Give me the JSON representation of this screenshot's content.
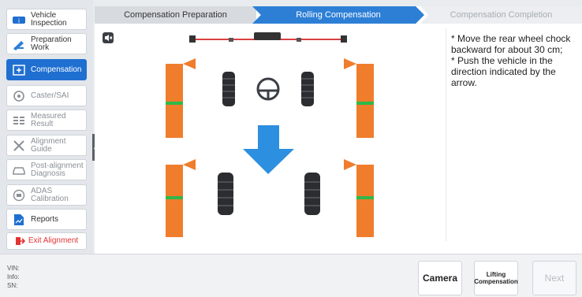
{
  "sidebar": {
    "items": [
      {
        "label_line1": "Vehicle",
        "label_line2": "Inspection",
        "icon": "car-info-icon",
        "state": "normal"
      },
      {
        "label_line1": "Preparation",
        "label_line2": "Work",
        "icon": "wrench-pencil-icon",
        "state": "normal"
      },
      {
        "label_line1": "Compensation",
        "label_line2": "",
        "icon": "compensation-icon",
        "state": "active"
      },
      {
        "label_line1": "Caster/SAI",
        "label_line2": "",
        "icon": "wheel-icon",
        "state": "disabled"
      },
      {
        "label_line1": "Measured",
        "label_line2": "Result",
        "icon": "list-icon",
        "state": "disabled"
      },
      {
        "label_line1": "Alignment",
        "label_line2": "Guide",
        "icon": "tools-icon",
        "state": "disabled"
      },
      {
        "label_line1": "Post-alignment",
        "label_line2": "Diagnosis",
        "icon": "car-diagnosis-icon",
        "state": "disabled"
      },
      {
        "label_line1": "ADAS",
        "label_line2": "Calibration",
        "icon": "adas-icon",
        "state": "disabled"
      },
      {
        "label_line1": "Reports",
        "label_line2": "",
        "icon": "report-icon",
        "state": "normal"
      }
    ],
    "exit_label": "Exit Alignment"
  },
  "steps": [
    "Compensation Preparation",
    "Rolling Compensation",
    "Compensation Completion"
  ],
  "instructions": [
    "* Move the rear wheel chock backward for about 30 cm;",
    "* Push the vehicle in the direction indicated by the arrow."
  ],
  "info": {
    "vin": "VIN:",
    "info": "Info:",
    "sn": "SN:"
  },
  "buttons": {
    "camera": "Camera",
    "lifting_line1": "Lifting",
    "lifting_line2": "Compensation",
    "next": "Next"
  },
  "colors": {
    "accent": "#2d7fd6",
    "target": "#f07d2c",
    "arrow": "#2d8fe0",
    "exit": "#e23434"
  }
}
